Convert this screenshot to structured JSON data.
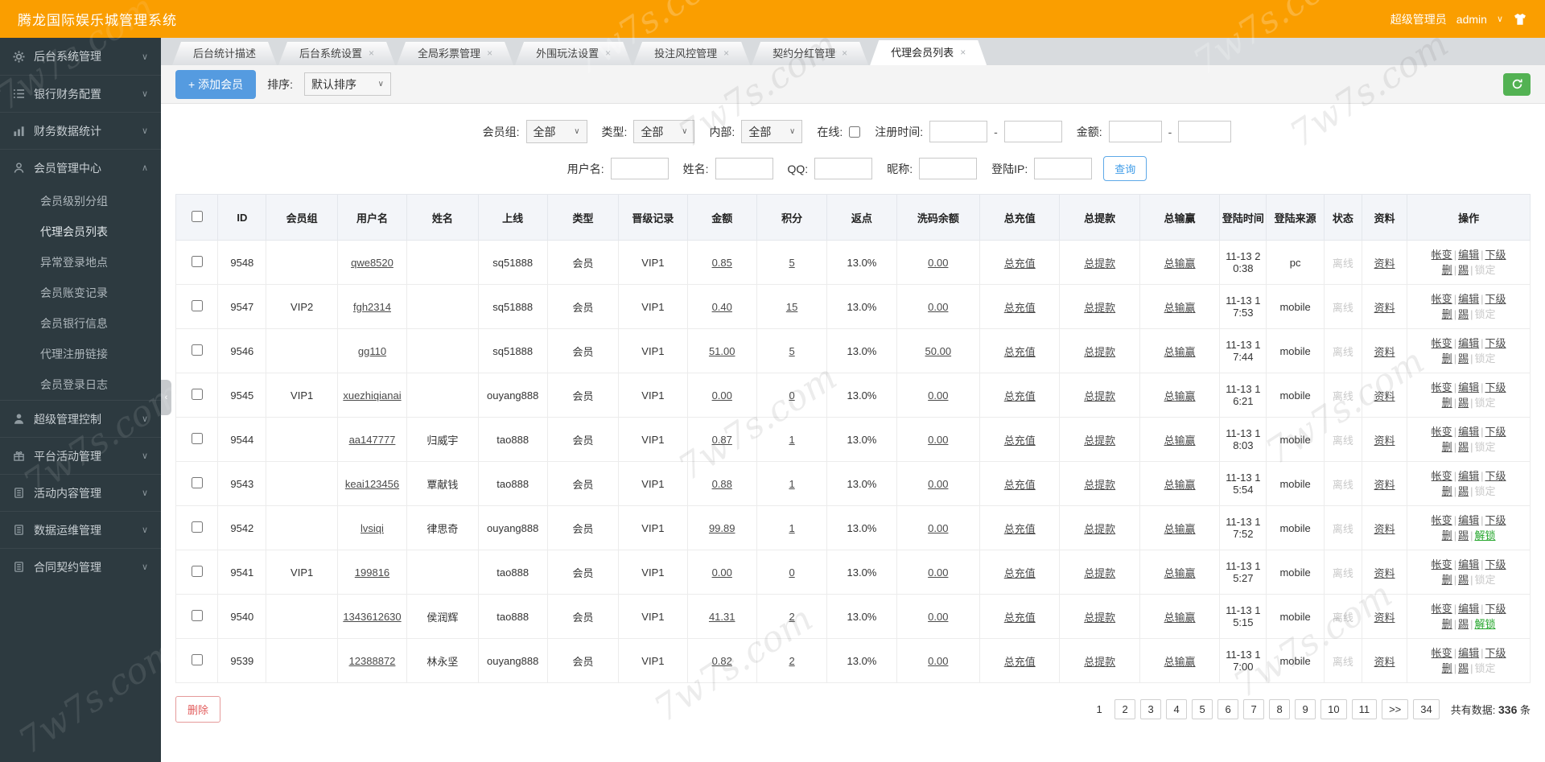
{
  "watermark": {
    "text": "7w7s.com"
  },
  "header": {
    "title": "腾龙国际娱乐城管理系统",
    "role": "超级管理员",
    "username": "admin"
  },
  "icons": {
    "tab_close": "×",
    "chevron_down": "∨",
    "chevron_up": "∧",
    "select_arrow": "∨",
    "collapse_arrow": "‹"
  },
  "sidebar": {
    "items": [
      {
        "label": "后台系统管理",
        "icon": "gear-icon",
        "expanded": false
      },
      {
        "label": "银行财务配置",
        "icon": "list-icon",
        "expanded": false
      },
      {
        "label": "财务数据统计",
        "icon": "chart-icon",
        "expanded": false
      },
      {
        "label": "会员管理中心",
        "icon": "user-icon",
        "expanded": true,
        "children": [
          "会员级别分组",
          "代理会员列表",
          "异常登录地点",
          "会员账变记录",
          "会员银行信息",
          "代理注册链接",
          "会员登录日志"
        ],
        "active_child": "代理会员列表"
      },
      {
        "label": "超级管理控制",
        "icon": "admin-icon",
        "expanded": false
      },
      {
        "label": "平台活动管理",
        "icon": "gift-icon",
        "expanded": false
      },
      {
        "label": "活动内容管理",
        "icon": "doc-icon",
        "expanded": false
      },
      {
        "label": "数据运维管理",
        "icon": "doc-icon",
        "expanded": false
      },
      {
        "label": "合同契约管理",
        "icon": "doc-icon",
        "expanded": false
      }
    ]
  },
  "tabs": [
    {
      "label": "后台统计描述",
      "closable": false,
      "active": false
    },
    {
      "label": "后台系统设置",
      "closable": true,
      "active": false
    },
    {
      "label": "全局彩票管理",
      "closable": true,
      "active": false
    },
    {
      "label": "外围玩法设置",
      "closable": true,
      "active": false
    },
    {
      "label": "投注风控管理",
      "closable": true,
      "active": false
    },
    {
      "label": "契约分红管理",
      "closable": true,
      "active": false
    },
    {
      "label": "代理会员列表",
      "closable": true,
      "active": true
    }
  ],
  "toolbar": {
    "add_button": "+ 添加会员",
    "sort_label": "排序:",
    "sort_value": "默认排序"
  },
  "filters": {
    "group_label": "会员组:",
    "group_value": "全部",
    "type_label": "类型:",
    "type_value": "全部",
    "internal_label": "内部:",
    "internal_value": "全部",
    "online_label": "在线:",
    "regtime_label": "注册时间:",
    "amount_label": "金额:",
    "dash": "-",
    "username_label": "用户名:",
    "name_label": "姓名:",
    "qq_label": "QQ:",
    "nick_label": "昵称:",
    "ip_label": "登陆IP:",
    "search_button": "查询"
  },
  "table": {
    "headers": [
      "ID",
      "会员组",
      "用户名",
      "姓名",
      "上线",
      "类型",
      "晋级记录",
      "金额",
      "积分",
      "返点",
      "洗码余额",
      "总充值",
      "总提款",
      "总输赢",
      "登陆时间",
      "登陆来源",
      "状态",
      "资料",
      "操作"
    ],
    "links": {
      "recharge": "总充值",
      "withdraw": "总提款",
      "winlose": "总输赢",
      "profile": "资料"
    },
    "ops": {
      "change": "帐变",
      "edit": "编辑",
      "lower": "下级",
      "del": "删",
      "kick": "踢",
      "lock": "锁定",
      "unlock": "解锁",
      "sep": "|"
    },
    "rows": [
      {
        "id": "9548",
        "group": "",
        "username": "qwe8520",
        "name": "",
        "upline": "sq51888",
        "type": "会员",
        "promote": "VIP1",
        "amount": "0.85",
        "points": "5",
        "rebate": "13.0%",
        "wash": "0.00",
        "login_time": "11-13 20:38",
        "source": "pc",
        "status": "离线",
        "unlocked": false
      },
      {
        "id": "9547",
        "group": "VIP2",
        "username": "fgh2314",
        "name": "",
        "upline": "sq51888",
        "type": "会员",
        "promote": "VIP1",
        "amount": "0.40",
        "points": "15",
        "rebate": "13.0%",
        "wash": "0.00",
        "login_time": "11-13 17:53",
        "source": "mobile",
        "status": "离线",
        "unlocked": false
      },
      {
        "id": "9546",
        "group": "",
        "username": "gg110",
        "name": "",
        "upline": "sq51888",
        "type": "会员",
        "promote": "VIP1",
        "amount": "51.00",
        "points": "5",
        "rebate": "13.0%",
        "wash": "50.00",
        "login_time": "11-13 17:44",
        "source": "mobile",
        "status": "离线",
        "unlocked": false
      },
      {
        "id": "9545",
        "group": "VIP1",
        "username": "xuezhiqianai",
        "name": "",
        "upline": "ouyang888",
        "type": "会员",
        "promote": "VIP1",
        "amount": "0.00",
        "points": "0",
        "rebate": "13.0%",
        "wash": "0.00",
        "login_time": "11-13 16:21",
        "source": "mobile",
        "status": "离线",
        "unlocked": false
      },
      {
        "id": "9544",
        "group": "",
        "username": "aa147777",
        "name": "归威宇",
        "upline": "tao888",
        "type": "会员",
        "promote": "VIP1",
        "amount": "0.87",
        "points": "1",
        "rebate": "13.0%",
        "wash": "0.00",
        "login_time": "11-13 18:03",
        "source": "mobile",
        "status": "离线",
        "unlocked": false
      },
      {
        "id": "9543",
        "group": "",
        "username": "keai123456",
        "name": "覃献钱",
        "upline": "tao888",
        "type": "会员",
        "promote": "VIP1",
        "amount": "0.88",
        "points": "1",
        "rebate": "13.0%",
        "wash": "0.00",
        "login_time": "11-13 15:54",
        "source": "mobile",
        "status": "离线",
        "unlocked": false
      },
      {
        "id": "9542",
        "group": "",
        "username": "lvsiqi",
        "name": "律思奇",
        "upline": "ouyang888",
        "type": "会员",
        "promote": "VIP1",
        "amount": "99.89",
        "points": "1",
        "rebate": "13.0%",
        "wash": "0.00",
        "login_time": "11-13 17:52",
        "source": "mobile",
        "status": "离线",
        "unlocked": true
      },
      {
        "id": "9541",
        "group": "VIP1",
        "username": "199816",
        "name": "",
        "upline": "tao888",
        "type": "会员",
        "promote": "VIP1",
        "amount": "0.00",
        "points": "0",
        "rebate": "13.0%",
        "wash": "0.00",
        "login_time": "11-13 15:27",
        "source": "mobile",
        "status": "离线",
        "unlocked": false
      },
      {
        "id": "9540",
        "group": "",
        "username": "1343612630",
        "name": "侯润辉",
        "upline": "tao888",
        "type": "会员",
        "promote": "VIP1",
        "amount": "41.31",
        "points": "2",
        "rebate": "13.0%",
        "wash": "0.00",
        "login_time": "11-13 15:15",
        "source": "mobile",
        "status": "离线",
        "unlocked": true
      },
      {
        "id": "9539",
        "group": "",
        "username": "12388872",
        "name": "林永坚",
        "upline": "ouyang888",
        "type": "会员",
        "promote": "VIP1",
        "amount": "0.82",
        "points": "2",
        "rebate": "13.0%",
        "wash": "0.00",
        "login_time": "11-13 17:00",
        "source": "mobile",
        "status": "离线",
        "unlocked": false
      }
    ]
  },
  "footer": {
    "delete_button": "删除",
    "pages": [
      "1",
      "2",
      "3",
      "4",
      "5",
      "6",
      "7",
      "8",
      "9",
      "10",
      "11",
      ">>",
      "34"
    ],
    "current_page": "1",
    "total_label": "共有数据:",
    "total_value": "336",
    "total_unit": "条"
  }
}
